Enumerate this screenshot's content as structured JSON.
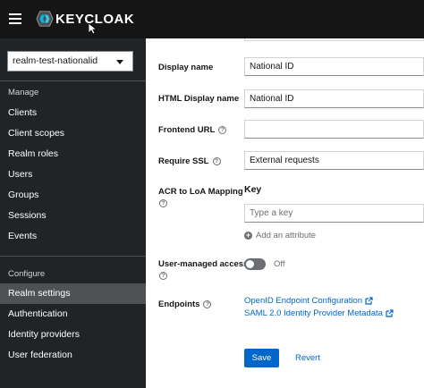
{
  "header": {
    "logo_text": "KEYCLOAK",
    "menu_icon": "hamburger-icon"
  },
  "sidebar": {
    "realm": "realm-test-nationalid",
    "manage_title": "Manage",
    "manage_items": [
      "Clients",
      "Client scopes",
      "Realm roles",
      "Users",
      "Groups",
      "Sessions",
      "Events"
    ],
    "configure_title": "Configure",
    "configure_items": [
      "Realm settings",
      "Authentication",
      "Identity providers",
      "User federation"
    ],
    "active_item": "Realm settings"
  },
  "form": {
    "display_name_label": "Display name",
    "display_name_value": "National ID",
    "html_display_name_label": "HTML Display name",
    "html_display_name_value": "National ID",
    "frontend_url_label": "Frontend URL",
    "frontend_url_value": "",
    "require_ssl_label": "Require SSL",
    "require_ssl_value": "External requests",
    "acr_label": "ACR to LoA Mapping",
    "key_header": "Key",
    "key_placeholder": "Type a key",
    "add_attribute": "Add an attribute",
    "user_managed_access_label": "User-managed access",
    "user_managed_access_state": "Off",
    "endpoints_label": "Endpoints",
    "endpoint_links": [
      "OpenID Endpoint Configuration",
      "SAML 2.0 Identity Provider Metadata"
    ],
    "save_label": "Save",
    "revert_label": "Revert"
  },
  "colors": {
    "topbar": "#151515",
    "sidebar": "#212427",
    "active_nav": "#4f5255",
    "primary": "#0066cc"
  }
}
